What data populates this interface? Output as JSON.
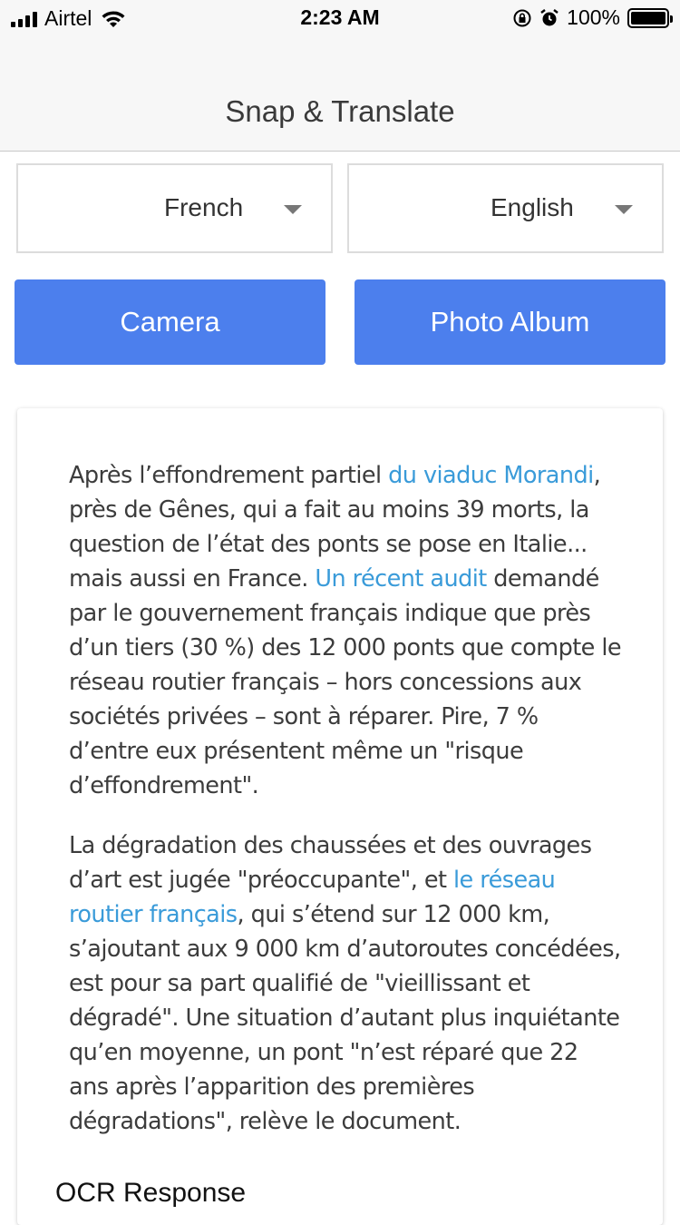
{
  "status_bar": {
    "carrier": "Airtel",
    "time": "2:23 AM",
    "battery": "100%",
    "battery_level": 1.0,
    "icons": [
      "signal-icon",
      "wifi-icon",
      "rotation-lock-icon",
      "alarm-icon",
      "battery-icon"
    ]
  },
  "nav": {
    "title": "Snap & Translate"
  },
  "languages": {
    "source": "French",
    "target": "English"
  },
  "buttons": {
    "camera": "Camera",
    "album": "Photo Album"
  },
  "document": {
    "paragraphs": [
      [
        {
          "text": "Après l’effondrement partiel ",
          "link": false
        },
        {
          "text": "du viaduc Morandi",
          "link": true
        },
        {
          "text": ", près de Gênes, qui a fait au moins 39 morts, la question de l’état des ponts se pose en Italie... mais aussi en France. ",
          "link": false
        },
        {
          "text": "Un récent audit",
          "link": true
        },
        {
          "text": " demandé par le gouvernement français indique que près d’un tiers (30 %) des 12 000 ponts que compte le réseau routier français – hors concessions aux sociétés privées – sont à réparer. Pire, 7 % d’entre eux présentent même un \"risque d’effondrement\".",
          "link": false
        }
      ],
      [
        {
          "text": "La dégradation des chaussées et des ouvrages d’art est jugée \"préoccupante\", et ",
          "link": false
        },
        {
          "text": "le réseau routier français",
          "link": true
        },
        {
          "text": ", qui s’étend sur 12 000 km, s’ajoutant aux 9 000 km d’autoroutes concédées, est pour sa part qualifié de \"vieillissant et dégradé\". Une situation d’autant plus inquiétante qu’en moyenne, un pont \"n’est réparé que 22 ans après l’apparition des premières dégradations\", relève le document.",
          "link": false
        }
      ]
    ]
  },
  "ocr": {
    "label": "OCR Response"
  },
  "colors": {
    "accent": "#4c7fed",
    "link": "#3a9bd9"
  }
}
